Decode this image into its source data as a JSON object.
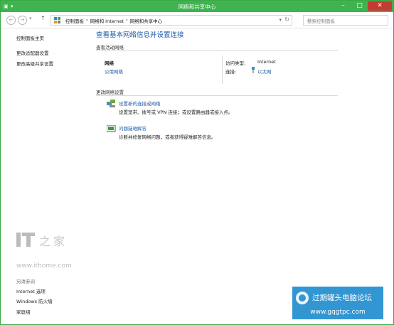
{
  "window": {
    "title": "网络和共享中心"
  },
  "address_bar": {
    "crumbs": [
      "控制面板",
      "›",
      "网络和 Internet",
      "›",
      "网络和共享中心"
    ],
    "search_placeholder": "搜索控制面板"
  },
  "sidebar": {
    "links": [
      "控制面板主页",
      "更改适配器设置",
      "更改高级共享设置"
    ],
    "see_also_title": "另请参阅",
    "see_also": [
      "Internet 选项",
      "Windows 防火墙",
      "家庭组"
    ]
  },
  "main": {
    "title": "查看基本网络信息并设置连接",
    "active_networks_title": "查看活动网络",
    "network": {
      "name": "网络",
      "type": "公用网络",
      "access_label": "访问类型:",
      "access_value": "Internet",
      "connection_label": "连接:",
      "connection_value": "以太网"
    },
    "change_settings_title": "更改网络设置",
    "tasks": [
      {
        "title": "设置新的连接或网络",
        "desc": "设置宽带、拨号或 VPN 连接；或设置路由器或接入点。"
      },
      {
        "title": "问题疑难解答",
        "desc": "诊断并修复网络问题，或者获得疑难解答信息。"
      }
    ]
  },
  "watermark": {
    "logo": "IT之家",
    "url": "www.ithome.com"
  },
  "footer_ad": {
    "text": "过期罐头电脑论坛",
    "url": "www.gqgtpc.com"
  },
  "colors": {
    "titlebar": "#3fb34f",
    "link": "#1e5ba8",
    "close": "#c53b31"
  }
}
